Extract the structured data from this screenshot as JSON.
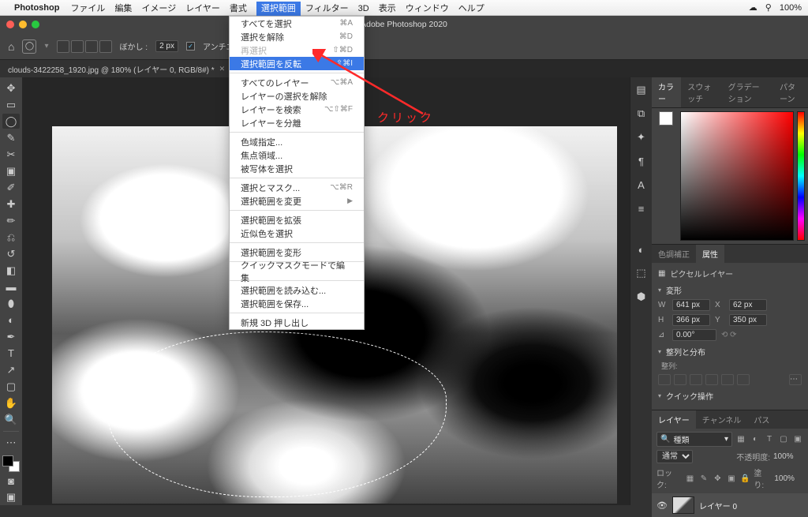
{
  "mac": {
    "app": "Photoshop",
    "menus": [
      "ファイル",
      "編集",
      "イメージ",
      "レイヤー",
      "書式",
      "選択範囲",
      "フィルター",
      "3D",
      "表示",
      "ウィンドウ",
      "ヘルプ"
    ],
    "active_menu_index": 5,
    "right": {
      "battery": "100%"
    }
  },
  "window_title": "Adobe Photoshop 2020",
  "options_bar": {
    "feather_label": "ぼかし :",
    "feather_value": "2 px",
    "antialias": "アンチエイリアス"
  },
  "doc_tab": "clouds-3422258_1920.jpg @ 180% (レイヤー 0, RGB/8#) *",
  "menu": {
    "items": [
      {
        "label": "すべてを選択",
        "sc": "⌘A"
      },
      {
        "label": "選択を解除",
        "sc": "⌘D"
      },
      {
        "label": "再選択",
        "sc": "⇧⌘D",
        "disabled": true
      },
      {
        "label": "選択範囲を反転",
        "sc": "⇧⌘I",
        "hl": true
      },
      {
        "sep": true
      },
      {
        "label": "すべてのレイヤー",
        "sc": "⌥⌘A"
      },
      {
        "label": "レイヤーの選択を解除"
      },
      {
        "label": "レイヤーを検索",
        "sc": "⌥⇧⌘F"
      },
      {
        "label": "レイヤーを分離"
      },
      {
        "sep": true
      },
      {
        "label": "色域指定..."
      },
      {
        "label": "焦点領域..."
      },
      {
        "label": "被写体を選択"
      },
      {
        "sep": true
      },
      {
        "label": "選択とマスク...",
        "sc": "⌥⌘R"
      },
      {
        "label": "選択範囲を変更",
        "sub": "▶"
      },
      {
        "sep": true
      },
      {
        "label": "選択範囲を拡張"
      },
      {
        "label": "近似色を選択"
      },
      {
        "sep": true
      },
      {
        "label": "選択範囲を変形"
      },
      {
        "sep": true
      },
      {
        "label": "クイックマスクモードで編集"
      },
      {
        "sep": true
      },
      {
        "label": "選択範囲を読み込む..."
      },
      {
        "label": "選択範囲を保存..."
      },
      {
        "sep": true
      },
      {
        "label": "新規 3D 押し出し"
      }
    ]
  },
  "annotation": "クリック",
  "panels": {
    "color_tabs": [
      "カラー",
      "スウォッチ",
      "グラデーション",
      "パターン"
    ],
    "props_tabs": [
      "色調補正",
      "属性"
    ],
    "props_title": "ピクセルレイヤー",
    "transform_label": "変形",
    "w": "641 px",
    "x": "62 px",
    "h": "366 px",
    "y": "350 px",
    "angle": "0.00°",
    "align_label": "整列と分布",
    "align_sub": "整列:",
    "quick_label": "クイック操作",
    "layers_tabs": [
      "レイヤー",
      "チャンネル",
      "パス"
    ],
    "search_label": "種類",
    "blend": "通常",
    "opacity_label": "不透明度:",
    "opacity": "100%",
    "lock_label": "ロック:",
    "fill_label": "塗り:",
    "fill": "100%",
    "layer0": "レイヤー 0"
  }
}
